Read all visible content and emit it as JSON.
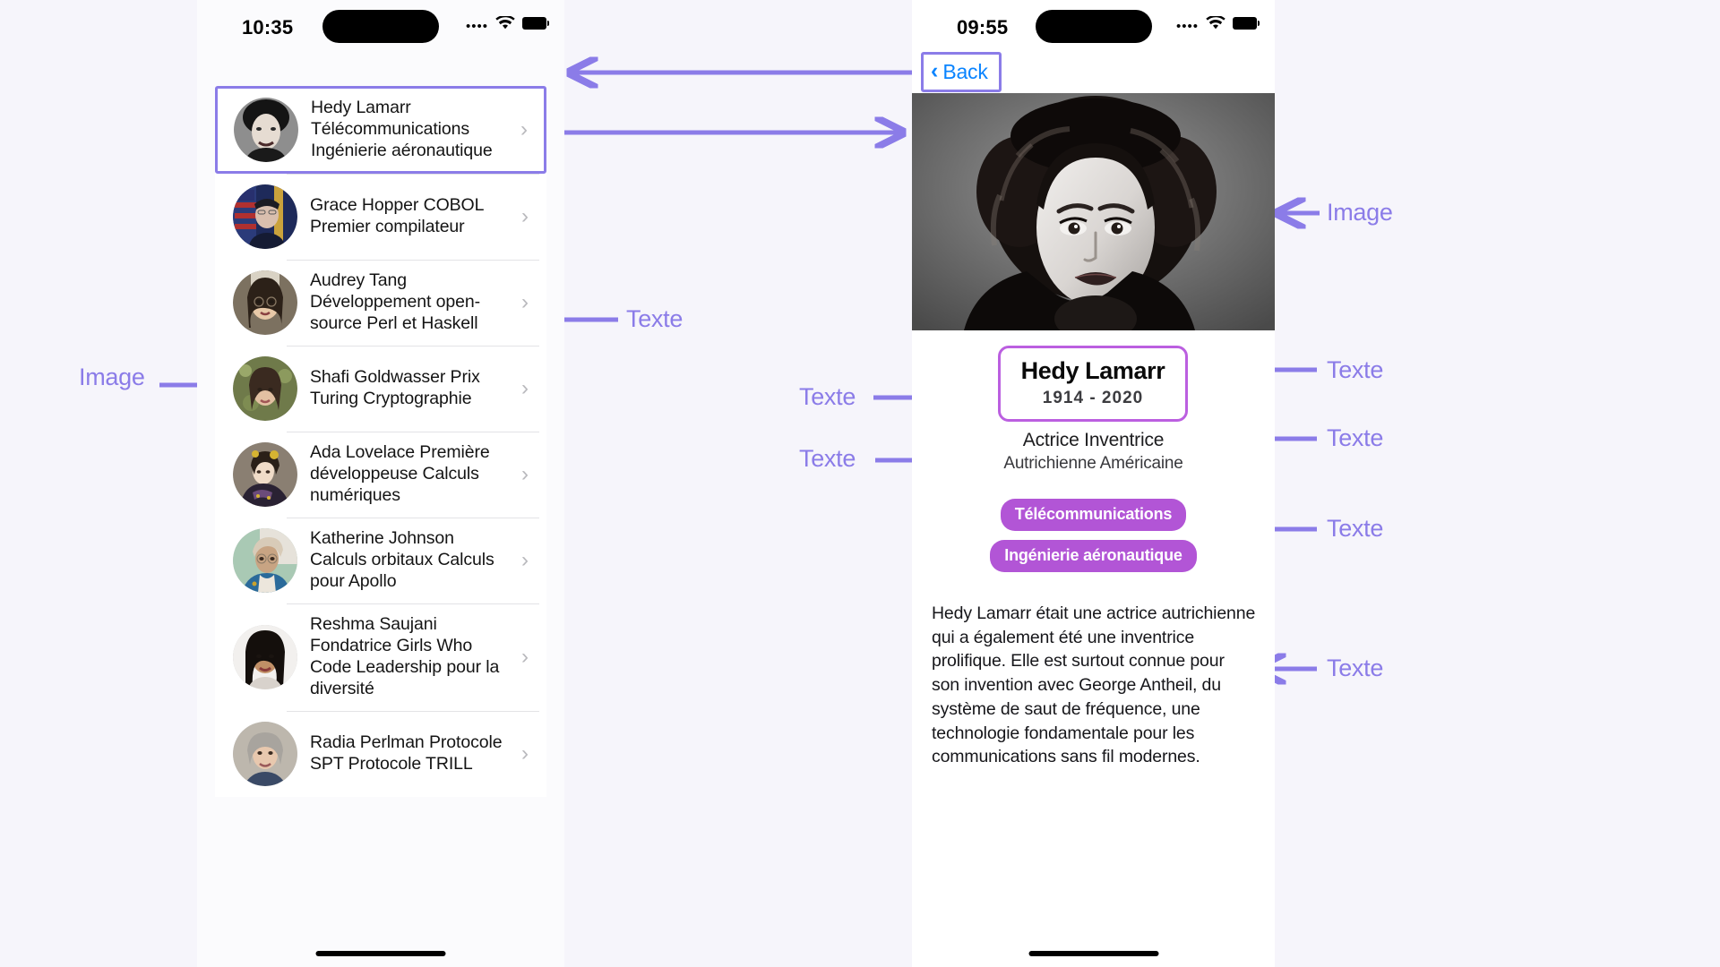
{
  "annotations": {
    "image_label": "Image",
    "text_label": "Texte",
    "items": [
      {
        "id": "anno-image-list",
        "label": "Image"
      },
      {
        "id": "anno-text-list",
        "label": "Texte"
      },
      {
        "id": "anno-image-detail",
        "label": "Image"
      },
      {
        "id": "anno-text-name",
        "label": "Texte"
      },
      {
        "id": "anno-text-dates",
        "label": "Texte"
      },
      {
        "id": "anno-text-roles",
        "label": "Texte"
      },
      {
        "id": "anno-text-nationalities",
        "label": "Texte"
      },
      {
        "id": "anno-text-tags",
        "label": "Texte"
      },
      {
        "id": "anno-text-bio",
        "label": "Texte"
      }
    ]
  },
  "list_screen": {
    "status_bar": {
      "time": "10:35",
      "dots": "••••",
      "wifi_icon": "wifi-icon",
      "battery_icon": "battery-icon"
    },
    "rows": [
      {
        "name": "Hedy Lamarr",
        "desc": "Télécommunications Ingénierie aéronautique",
        "avatar": "hedy-lamarr-avatar",
        "selected": true,
        "chevron": "›"
      },
      {
        "name": "Grace Hopper",
        "desc": "COBOL Premier compilateur",
        "full": "Grace Hopper COBOL Premier compilateur",
        "avatar": "grace-hopper-avatar",
        "selected": false,
        "chevron": "›"
      },
      {
        "name": "Audrey Tang",
        "desc": "Développement open-source Perl et Haskell",
        "full": "Audrey Tang Développement open-source Perl et Haskell",
        "avatar": "audrey-tang-avatar",
        "selected": false,
        "chevron": "›"
      },
      {
        "name": "Shafi Goldwasser",
        "desc": "Prix Turing Cryptographie",
        "full": "Shafi Goldwasser Prix Turing Cryptographie",
        "avatar": "shafi-goldwasser-avatar",
        "selected": false,
        "chevron": "›"
      },
      {
        "name": "Ada Lovelace",
        "desc": "Première développeuse Calculs numériques",
        "full": "Ada Lovelace Première développeuse Calculs numériques",
        "avatar": "ada-lovelace-avatar",
        "selected": false,
        "chevron": "›"
      },
      {
        "name": "Katherine Johnson",
        "desc": "Calculs orbitaux Calculs pour Apollo",
        "full": "Katherine Johnson Calculs orbitaux Calculs pour Apollo",
        "avatar": "katherine-johnson-avatar",
        "selected": false,
        "chevron": "›"
      },
      {
        "name": "Reshma Saujani",
        "desc": "Fondatrice Girls Who Code Leadership pour la diversité",
        "full": "Reshma Saujani Fondatrice Girls Who Code Leadership pour la diversité",
        "avatar": "reshma-saujani-avatar",
        "selected": false,
        "chevron": "›"
      },
      {
        "name": "Radia Perlman",
        "desc": "Protocole SPT Protocole TRILL",
        "full": "Radia Perlman Protocole SPT Protocole TRILL",
        "avatar": "radia-perlman-avatar",
        "selected": false,
        "chevron": "›"
      }
    ],
    "row_texts": [
      "Hedy Lamarr Télécommunications Ingénierie aéronautique",
      "Grace Hopper COBOL Premier compilateur",
      "Audrey Tang Développement open-source Perl et Haskell",
      "Shafi Goldwasser Prix Turing Cryptographie",
      "Ada Lovelace Première développeuse Calculs numériques",
      "Katherine Johnson Calculs orbitaux Calculs pour Apollo",
      "Reshma Saujani Fondatrice Girls Who Code Leadership pour la diversité",
      "Radia Perlman Protocole SPT Protocole TRILL"
    ]
  },
  "detail_screen": {
    "status_bar": {
      "time": "09:55",
      "dots": "••••",
      "wifi_icon": "wifi-icon",
      "battery_icon": "battery-icon"
    },
    "back_button": {
      "label": "Back",
      "chevron": "‹"
    },
    "hero_image": "hedy-lamarr-portrait",
    "name": "Hedy Lamarr",
    "dates": "1914  -  2020",
    "roles": "Actrice  Inventrice",
    "nationalities": "Autrichienne  Américaine",
    "tags": [
      "Télécommunications",
      "Ingénierie aéronautique"
    ],
    "biography": "Hedy Lamarr était une actrice autrichienne qui a également été une inventrice prolifique. Elle est surtout connue pour son invention avec George Antheil, du système de saut de fréquence, une technologie fondamentale pour les communications sans fil modernes."
  },
  "colors": {
    "annotation_purple": "#8b7ce8",
    "card_border_magenta": "#bb5fe0",
    "tag_purple": "#b255d6",
    "ios_blue": "#0a84ff",
    "page_background": "#f6f5fb"
  }
}
